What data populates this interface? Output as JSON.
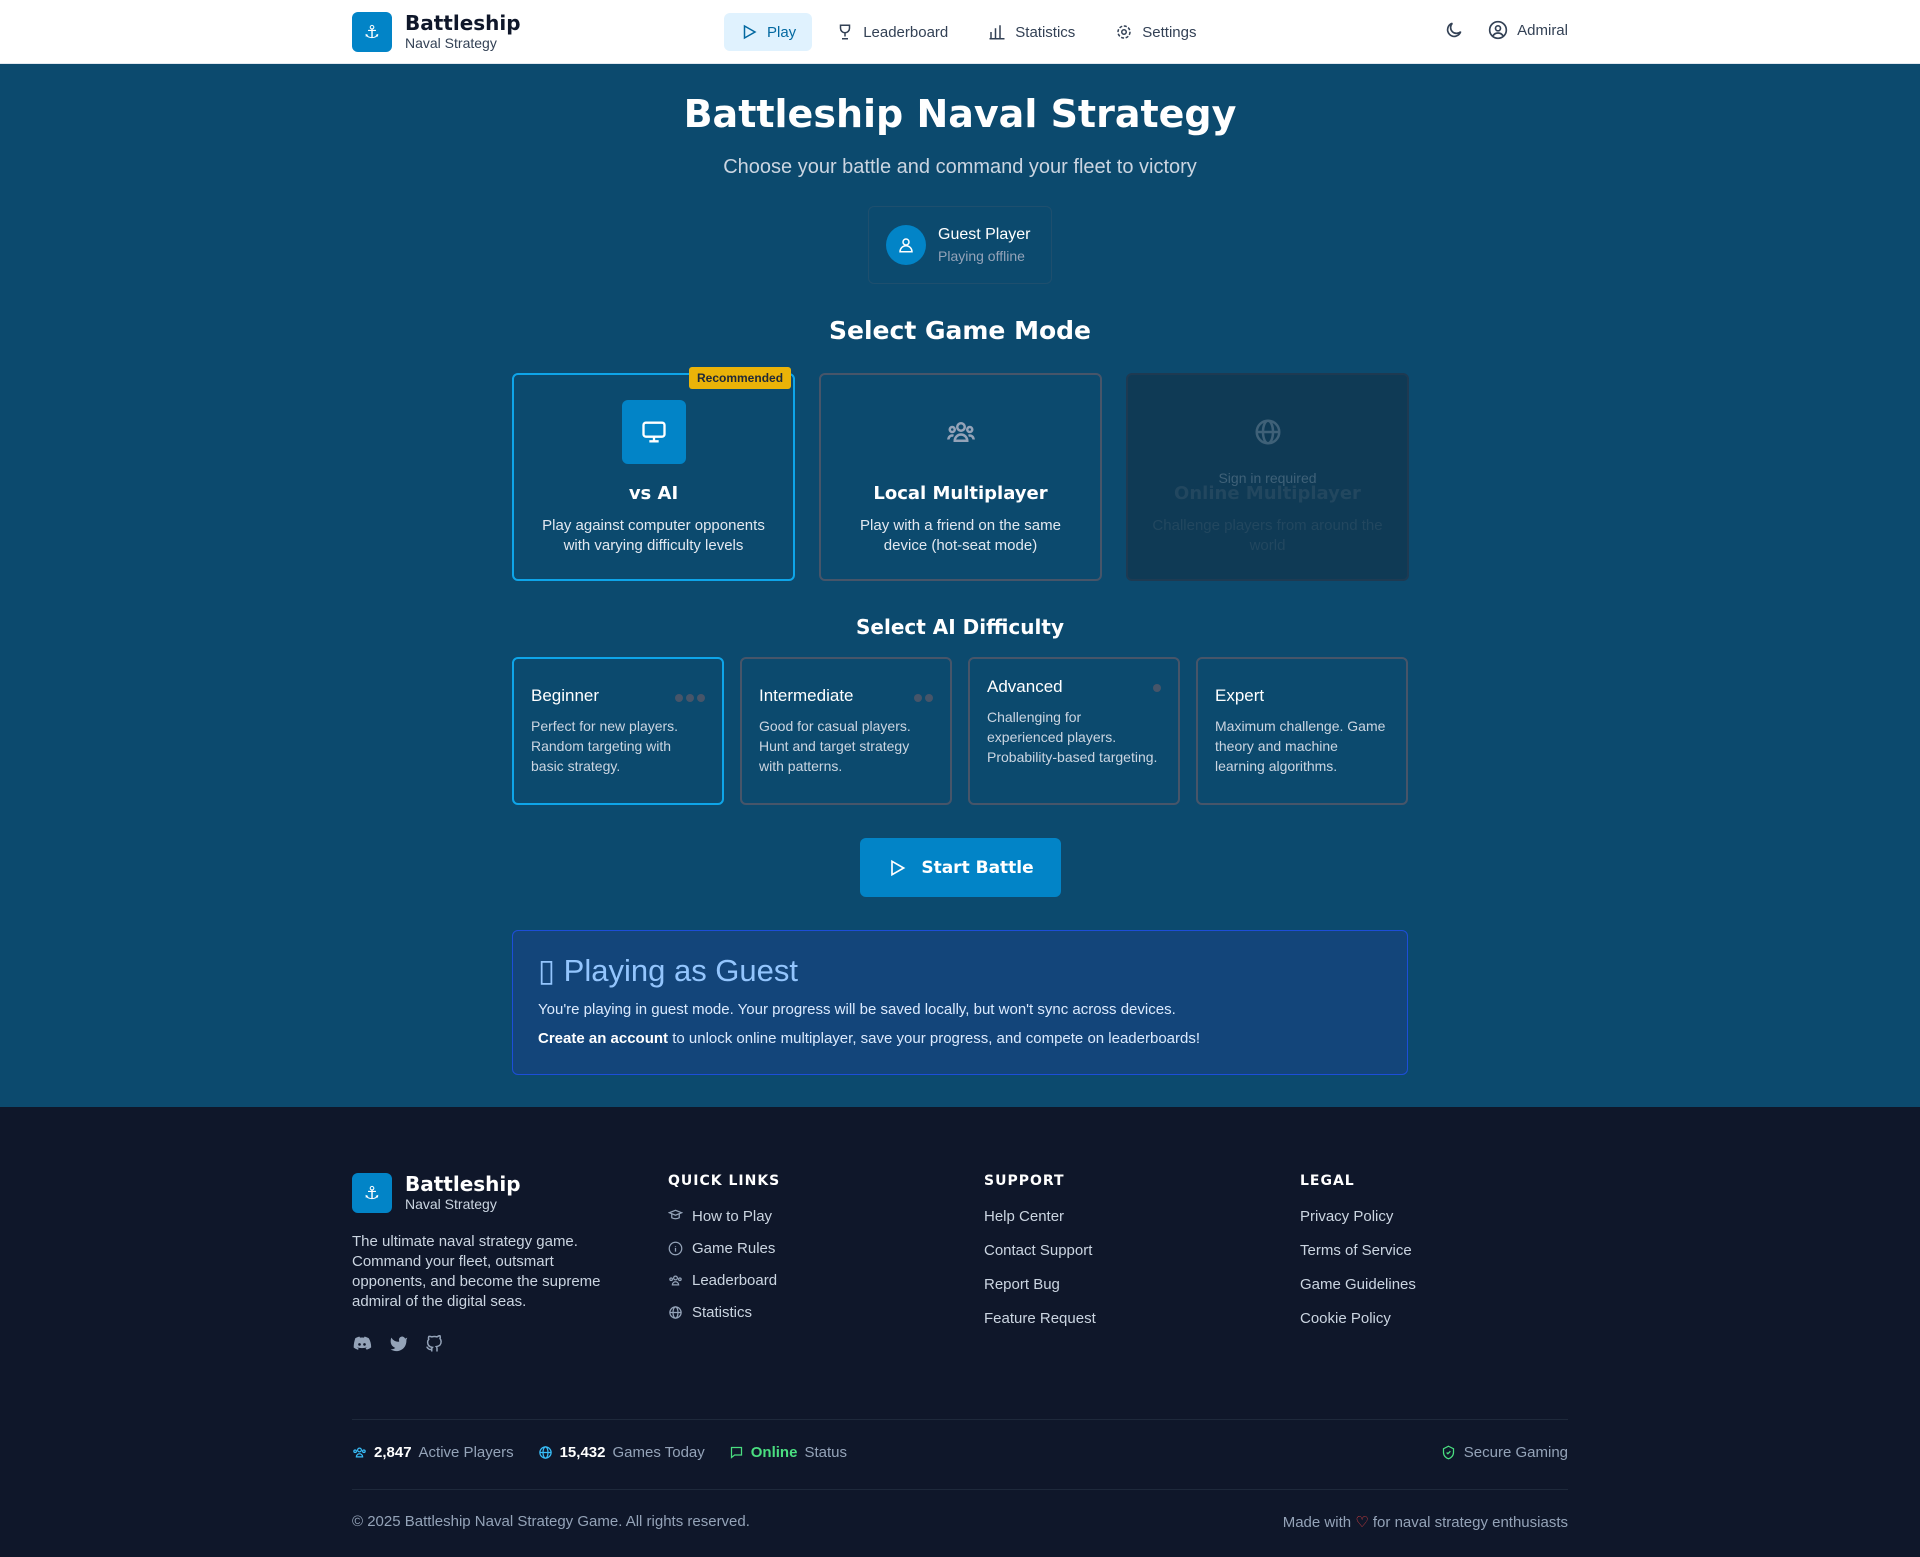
{
  "app": {
    "title": "Battleship",
    "subtitle": "Naval Strategy"
  },
  "nav": {
    "items": [
      {
        "label": "Play",
        "icon": "play-icon",
        "active": true
      },
      {
        "label": "Leaderboard",
        "icon": "trophy-icon",
        "active": false
      },
      {
        "label": "Statistics",
        "icon": "bar-chart-icon",
        "active": false
      },
      {
        "label": "Settings",
        "icon": "gear-icon",
        "active": false
      }
    ],
    "user": "Admiral"
  },
  "hero": {
    "title": "Battleship Naval Strategy",
    "subtitle": "Choose your battle and command your fleet to victory"
  },
  "guest": {
    "name": "Guest Player",
    "status": "Playing offline"
  },
  "modes": {
    "title": "Select Game Mode",
    "badge": "Recommended",
    "items": [
      {
        "name": "vs AI",
        "desc": "Play against computer opponents with varying difficulty levels",
        "icon": "monitor-icon",
        "selected": true
      },
      {
        "name": "Local Multiplayer",
        "desc": "Play with a friend on the same device (hot-seat mode)",
        "icon": "users-icon",
        "selected": false
      },
      {
        "name": "Online Multiplayer",
        "desc": "Challenge players from around the world",
        "icon": "globe-icon",
        "selected": false,
        "disabled": true,
        "note": "Sign in required"
      }
    ]
  },
  "difficulty": {
    "title": "Select AI Difficulty",
    "items": [
      {
        "name": "Beginner",
        "desc": "Perfect for new players. Random targeting with basic strategy.",
        "dots": 3,
        "selected": true
      },
      {
        "name": "Intermediate",
        "desc": "Good for casual players. Hunt and target strategy with patterns.",
        "dots": 2,
        "selected": false
      },
      {
        "name": "Advanced",
        "desc": "Challenging for experienced players. Probability-based targeting.",
        "dots": 1,
        "selected": false
      },
      {
        "name": "Expert",
        "desc": "Maximum challenge. Game theory and machine learning algorithms.",
        "dots": 0,
        "selected": false
      }
    ]
  },
  "start": {
    "label": "Start Battle"
  },
  "guest_info": {
    "title": "▯ Playing as Guest",
    "line1": "You're playing in guest mode. Your progress will be saved locally, but won't sync across devices.",
    "line2_bold": "Create an account",
    "line2_rest": " to unlock online multiplayer, save your progress, and compete on leaderboards!"
  },
  "footer": {
    "about": "The ultimate naval strategy game. Command your fleet, outsmart opponents, and become the supreme admiral of the digital seas.",
    "quick_title": "QUICK LINKS",
    "quick": [
      "How to Play",
      "Game Rules",
      "Leaderboard",
      "Statistics"
    ],
    "support_title": "SUPPORT",
    "support": [
      "Help Center",
      "Contact Support",
      "Report Bug",
      "Feature Request"
    ],
    "legal_title": "LEGAL",
    "legal": [
      "Privacy Policy",
      "Terms of Service",
      "Game Guidelines",
      "Cookie Policy"
    ],
    "stats": {
      "players_value": "2,847",
      "players_label": "Active Players",
      "games_value": "15,432",
      "games_label": "Games Today",
      "status_value": "Online",
      "status_label": "Status"
    },
    "secure": "Secure Gaming",
    "copyright": "© 2025 Battleship Naval Strategy Game. All rights reserved.",
    "made_prefix": "Made with",
    "made_suffix": "for naval strategy enthusiasts"
  },
  "colors": {
    "primary": "#0284c7",
    "background": "#0c4a6e",
    "footer": "#0f172a",
    "badge": "#eab308",
    "online": "#4ade80"
  }
}
